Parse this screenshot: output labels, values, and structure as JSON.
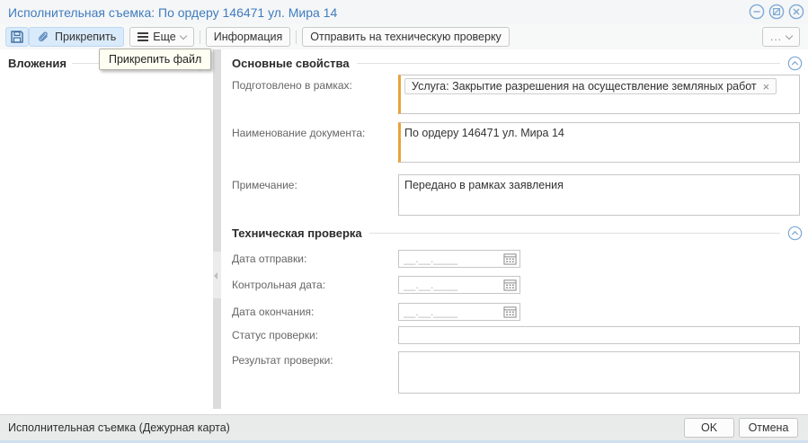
{
  "colors": {
    "accent_blue": "#3F7CBF",
    "modified_orange": "#E8A33D",
    "highlight_blue": "#D9EAFA"
  },
  "window": {
    "title": "Исполнительная съемка: По ордеру 146471 ул. Мира 14"
  },
  "toolbar": {
    "attach_label": "Прикрепить",
    "more_label": "Еще",
    "info_label": "Информация",
    "send_label": "Отправить на техническую проверку",
    "overflow_label": "..."
  },
  "tooltip": {
    "text": "Прикрепить файл"
  },
  "attachments_panel": {
    "title": "Вложения"
  },
  "main_section": {
    "title": "Основные свойства",
    "prepared_label": "Подготовлено в рамках:",
    "prepared_value": "Услуга: Закрытие разрешения на осуществление земляных работ",
    "remove_icon": "×",
    "doc_name_label": "Наименование документа:",
    "doc_name_value": "По ордеру 146471 ул. Мира 14",
    "note_label": "Примечание:",
    "note_value": "Передано в рамках заявления"
  },
  "check_section": {
    "title": "Техническая проверка",
    "date_placeholder": "__.__.____",
    "fields": [
      {
        "label": "Дата отправки:"
      },
      {
        "label": "Контрольная дата:"
      },
      {
        "label": "Дата окончания:"
      }
    ],
    "status_label": "Статус проверки:",
    "status_value": "",
    "result_label": "Результат проверки:",
    "result_value": ""
  },
  "footer": {
    "status_text": "Исполнительная съемка (Дежурная карта)",
    "ok_label": "OK",
    "cancel_label": "Отмена"
  }
}
